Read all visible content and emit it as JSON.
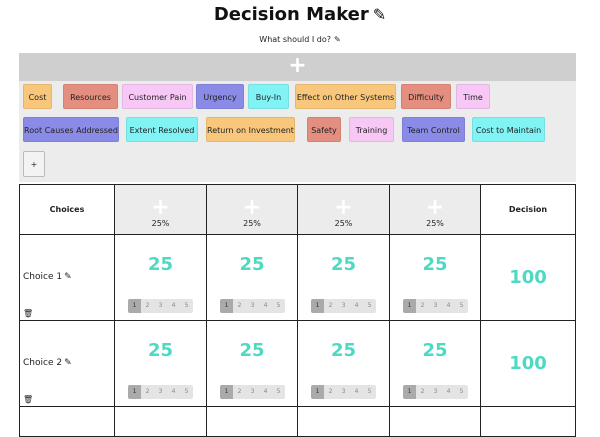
{
  "header": {
    "title": "Decision Maker",
    "title_icon": "edit-icon",
    "subtitle": "What should I do?",
    "subtitle_icon": "edit-icon"
  },
  "add_criteria_bar": {
    "label": "+"
  },
  "criteria": [
    {
      "label": "Cost",
      "color": "#f8c77b"
    },
    {
      "label": "Resources",
      "color": "#e48e7f"
    },
    {
      "label": "Customer Pain",
      "color": "#f7c7f6"
    },
    {
      "label": "Urgency",
      "color": "#8a8be7"
    },
    {
      "label": "Buy-In",
      "color": "#81f3f5"
    },
    {
      "label": "Effect on Other Systems",
      "color": "#f8c77b"
    },
    {
      "label": "Difficulty",
      "color": "#e48e7f"
    },
    {
      "label": "Time",
      "color": "#f7c7f6"
    },
    {
      "label": "Root Causes Addressed",
      "color": "#8a8be7"
    },
    {
      "label": "Extent Resolved",
      "color": "#81f3f5"
    },
    {
      "label": "Return on Investment",
      "color": "#f8c77b"
    },
    {
      "label": "Safety",
      "color": "#e48e7f"
    },
    {
      "label": "Training",
      "color": "#f7c7f6"
    },
    {
      "label": "Team Control",
      "color": "#8a8be7"
    },
    {
      "label": "Cost to Maintain",
      "color": "#81f3f5"
    }
  ],
  "add_criterion_button": "+",
  "table": {
    "choices_header": "Choices",
    "decision_header": "Decision",
    "columns": [
      {
        "plus": "+",
        "weight": "25%"
      },
      {
        "plus": "+",
        "weight": "25%"
      },
      {
        "plus": "+",
        "weight": "25%"
      },
      {
        "plus": "+",
        "weight": "25%"
      }
    ],
    "rows": [
      {
        "name": "Choice 1",
        "scores": [
          "25",
          "25",
          "25",
          "25"
        ],
        "selected": 1,
        "decision": "100"
      },
      {
        "name": "Choice 2",
        "scores": [
          "25",
          "25",
          "25",
          "25"
        ],
        "selected": 1,
        "decision": "100"
      },
      {
        "name": "",
        "scores": [
          "",
          "",
          "",
          ""
        ],
        "selected": 0,
        "decision": ""
      }
    ],
    "rating_options": [
      "1",
      "2",
      "3",
      "4",
      "5"
    ]
  },
  "accent_color": "#4ed9c3"
}
